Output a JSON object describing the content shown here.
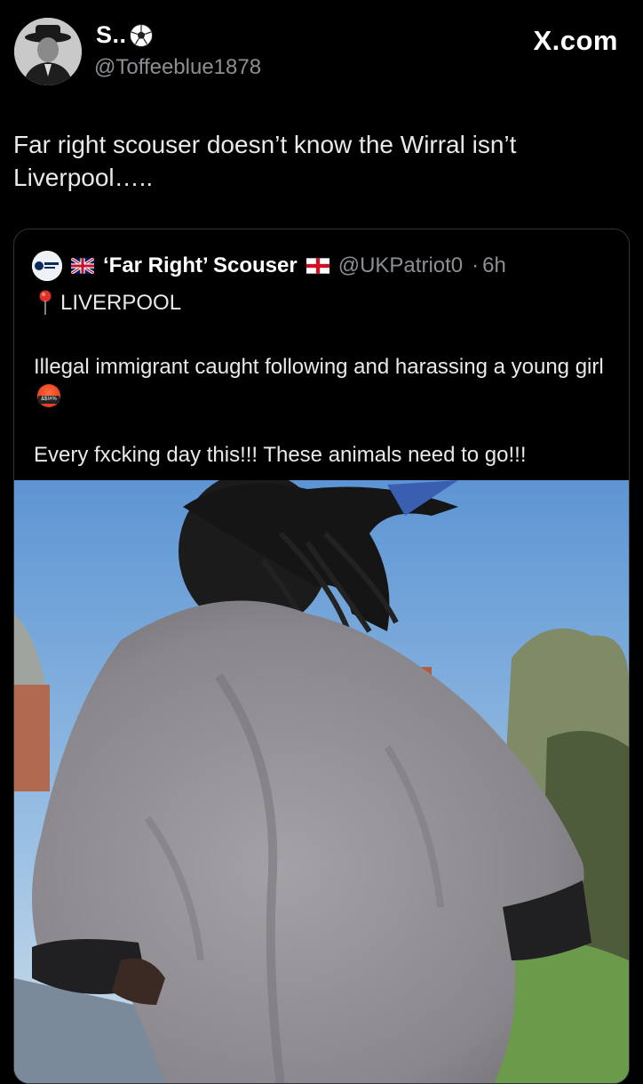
{
  "author": {
    "display_name": "S..",
    "name_emoji": "soccer-ball-icon",
    "handle": "@Toffeeblue1878"
  },
  "brand": "X.com",
  "post": {
    "text": "Far right scouser doesn’t know the Wirral isn’t Liverpool….."
  },
  "quoted_post": {
    "name_prefix_flag": "uk-flag-icon",
    "display_name": "‘Far Right’ Scouser",
    "name_suffix_flag": "england-flag-icon",
    "handle": "@UKPatriot0",
    "separator": "·",
    "time": "6h",
    "location_icon": "pin-icon",
    "location": "LIVERPOOL",
    "text_line1": "Illegal immigrant caught following and harassing a young girl",
    "text_line1_emoji": "angry-cursing-face-icon",
    "text_line2": "Every fxcking day this!!! These animals need to go!!!"
  },
  "colors": {
    "background": "#000000",
    "text_primary": "#e7e9ea",
    "text_secondary": "#8b8f94",
    "border": "#2f3336"
  }
}
